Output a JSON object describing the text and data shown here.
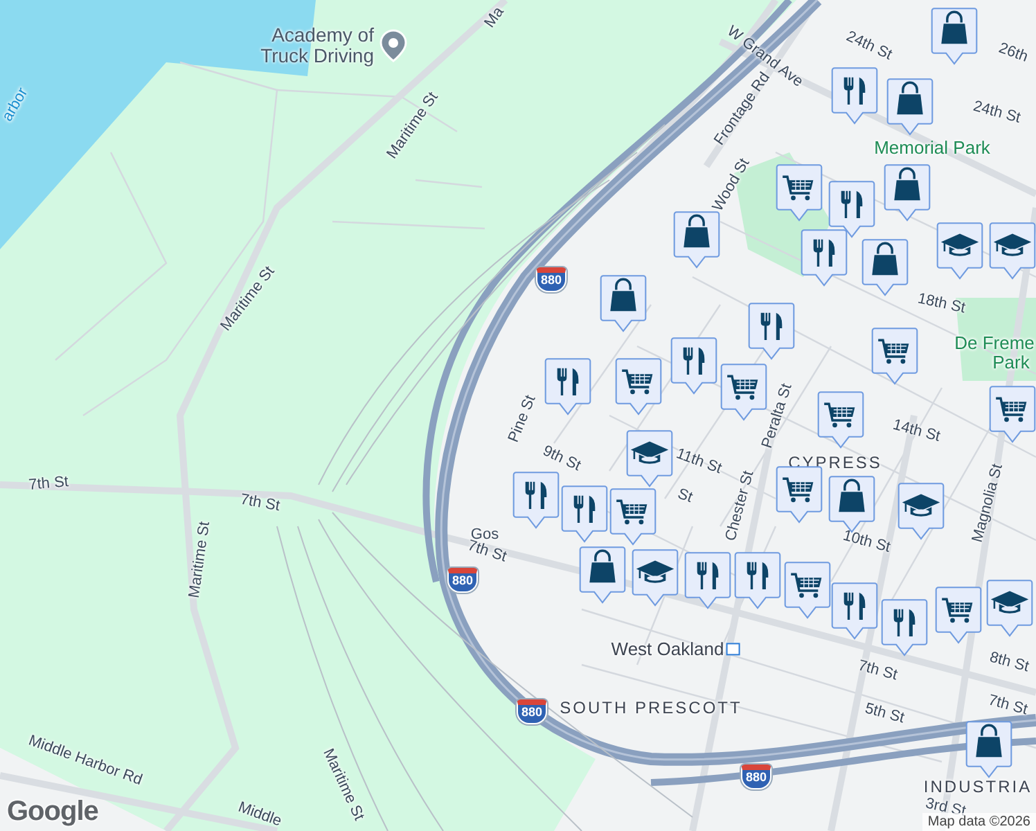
{
  "map": {
    "place": {
      "name": "Academy of Truck Driving"
    },
    "labels": [
      {
        "text": "arbor",
        "kind": "water"
      },
      {
        "text": "Maritime St",
        "kind": "street"
      },
      {
        "text": "Ma",
        "kind": "street"
      },
      {
        "text": "Maritime St",
        "kind": "street"
      },
      {
        "text": "W Grand Ave",
        "kind": "street"
      },
      {
        "text": "Frontage Rd",
        "kind": "street"
      },
      {
        "text": "Wood St",
        "kind": "street"
      },
      {
        "text": "24th St",
        "kind": "street"
      },
      {
        "text": "24th St",
        "kind": "street"
      },
      {
        "text": "26th",
        "kind": "street"
      },
      {
        "text": "Memorial Park",
        "kind": "park"
      },
      {
        "text": "18th St",
        "kind": "street"
      },
      {
        "text": "De Freme",
        "kind": "park"
      },
      {
        "text": "Park",
        "kind": "park"
      },
      {
        "text": "Pine St",
        "kind": "street"
      },
      {
        "text": "9th St",
        "kind": "street"
      },
      {
        "text": "11th St",
        "kind": "street"
      },
      {
        "text": "St",
        "kind": "street"
      },
      {
        "text": "Peralta St",
        "kind": "street"
      },
      {
        "text": "14th St",
        "kind": "street"
      },
      {
        "text": "CYPRESS",
        "kind": "district"
      },
      {
        "text": "Chester St",
        "kind": "street"
      },
      {
        "text": "10th St",
        "kind": "street"
      },
      {
        "text": "Magnolia St",
        "kind": "street"
      },
      {
        "text": "7th St",
        "kind": "street"
      },
      {
        "text": "7th St",
        "kind": "street"
      },
      {
        "text": "7th St",
        "kind": "street"
      },
      {
        "text": "7th St",
        "kind": "street"
      },
      {
        "text": "7th St",
        "kind": "street"
      },
      {
        "text": "Maritime St",
        "kind": "street"
      },
      {
        "text": "Maritime St",
        "kind": "street"
      },
      {
        "text": "Middle Harbor Rd",
        "kind": "street"
      },
      {
        "text": "Middle",
        "kind": "street"
      },
      {
        "text": "8th St",
        "kind": "street"
      },
      {
        "text": "5th St",
        "kind": "street"
      },
      {
        "text": "3rd St",
        "kind": "street"
      },
      {
        "text": "Gos",
        "kind": "street"
      },
      {
        "text": "West Oakland",
        "kind": "station"
      },
      {
        "text": "SOUTH PRESCOTT",
        "kind": "district"
      },
      {
        "text": "INDUSTRIA",
        "kind": "district"
      }
    ],
    "highway_shields": [
      {
        "text": "880"
      },
      {
        "text": "880"
      },
      {
        "text": "880"
      },
      {
        "text": "880"
      }
    ],
    "markers": [
      {
        "kind": "shop"
      },
      {
        "kind": "food"
      },
      {
        "kind": "shop"
      },
      {
        "kind": "cart"
      },
      {
        "kind": "food"
      },
      {
        "kind": "shop"
      },
      {
        "kind": "food"
      },
      {
        "kind": "shop"
      },
      {
        "kind": "shop"
      },
      {
        "kind": "school"
      },
      {
        "kind": "school"
      },
      {
        "kind": "shop"
      },
      {
        "kind": "food"
      },
      {
        "kind": "cart"
      },
      {
        "kind": "food"
      },
      {
        "kind": "food"
      },
      {
        "kind": "cart"
      },
      {
        "kind": "cart"
      },
      {
        "kind": "cart"
      },
      {
        "kind": "cart"
      },
      {
        "kind": "school"
      },
      {
        "kind": "food"
      },
      {
        "kind": "cart"
      },
      {
        "kind": "food"
      },
      {
        "kind": "shop"
      },
      {
        "kind": "school"
      },
      {
        "kind": "food"
      },
      {
        "kind": "food"
      },
      {
        "kind": "cart"
      },
      {
        "kind": "food"
      },
      {
        "kind": "cart"
      },
      {
        "kind": "shop"
      },
      {
        "kind": "school"
      },
      {
        "kind": "food"
      },
      {
        "kind": "cart"
      },
      {
        "kind": "school"
      },
      {
        "kind": "shop"
      }
    ],
    "logo": "Google",
    "attribution": "Map data ©2026"
  }
}
